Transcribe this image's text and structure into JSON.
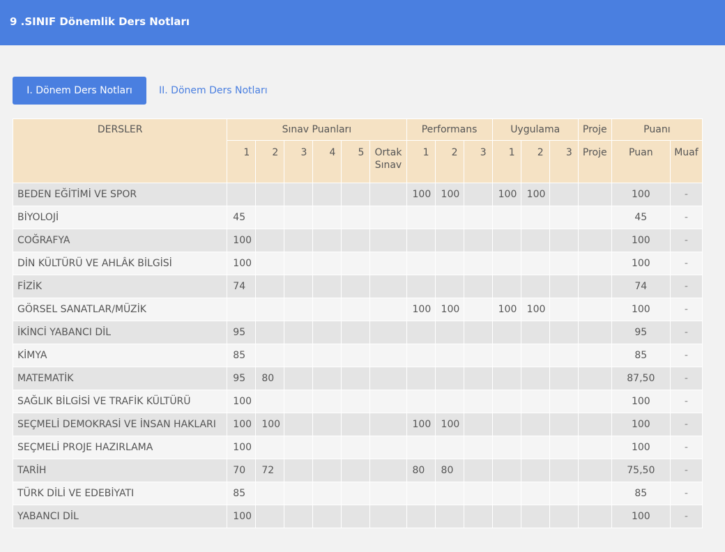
{
  "header": {
    "title": "9 .SINIF Dönemlik Ders Notları"
  },
  "tabs": [
    {
      "label": "I. Dönem Ders Notları",
      "active": true
    },
    {
      "label": "II. Dönem Ders Notları",
      "active": false
    }
  ],
  "colors": {
    "accent": "#4a7fe0",
    "header_bg": "#f5e2c4"
  },
  "table": {
    "group_headers": {
      "subjects": "DERSLER",
      "exam": "Sınav Puanları",
      "performance": "Performans",
      "application": "Uygulama",
      "project": "Proje",
      "score": "Puanı"
    },
    "sub_headers": {
      "e1": "1",
      "e2": "2",
      "e3": "3",
      "e4": "4",
      "e5": "5",
      "ortak_line1": "Ortak",
      "ortak_line2": "Sınav",
      "p1": "1",
      "p2": "2",
      "p3": "3",
      "u1": "1",
      "u2": "2",
      "u3": "3",
      "proje": "Proje",
      "puan": "Puan",
      "muaf": "Muaf"
    },
    "rows": [
      {
        "subject": "BEDEN EĞİTİMİ VE SPOR",
        "s1": "",
        "s2": "",
        "s3": "",
        "s4": "",
        "s5": "",
        "ortak": "",
        "p1": "100",
        "p2": "100",
        "p3": "",
        "u1": "100",
        "u2": "100",
        "u3": "",
        "proje": "",
        "puan": "100",
        "muaf": "-"
      },
      {
        "subject": "BİYOLOJİ",
        "s1": "45",
        "s2": "",
        "s3": "",
        "s4": "",
        "s5": "",
        "ortak": "",
        "p1": "",
        "p2": "",
        "p3": "",
        "u1": "",
        "u2": "",
        "u3": "",
        "proje": "",
        "puan": "45",
        "muaf": "-"
      },
      {
        "subject": "COĞRAFYA",
        "s1": "100",
        "s2": "",
        "s3": "",
        "s4": "",
        "s5": "",
        "ortak": "",
        "p1": "",
        "p2": "",
        "p3": "",
        "u1": "",
        "u2": "",
        "u3": "",
        "proje": "",
        "puan": "100",
        "muaf": "-"
      },
      {
        "subject": "DİN KÜLTÜRÜ VE AHLÂK BİLGİSİ",
        "s1": "100",
        "s2": "",
        "s3": "",
        "s4": "",
        "s5": "",
        "ortak": "",
        "p1": "",
        "p2": "",
        "p3": "",
        "u1": "",
        "u2": "",
        "u3": "",
        "proje": "",
        "puan": "100",
        "muaf": "-"
      },
      {
        "subject": "FİZİK",
        "s1": "74",
        "s2": "",
        "s3": "",
        "s4": "",
        "s5": "",
        "ortak": "",
        "p1": "",
        "p2": "",
        "p3": "",
        "u1": "",
        "u2": "",
        "u3": "",
        "proje": "",
        "puan": "74",
        "muaf": "-"
      },
      {
        "subject": "GÖRSEL SANATLAR/MÜZİK",
        "s1": "",
        "s2": "",
        "s3": "",
        "s4": "",
        "s5": "",
        "ortak": "",
        "p1": "100",
        "p2": "100",
        "p3": "",
        "u1": "100",
        "u2": "100",
        "u3": "",
        "proje": "",
        "puan": "100",
        "muaf": "-"
      },
      {
        "subject": "İKİNCİ YABANCI DİL",
        "s1": "95",
        "s2": "",
        "s3": "",
        "s4": "",
        "s5": "",
        "ortak": "",
        "p1": "",
        "p2": "",
        "p3": "",
        "u1": "",
        "u2": "",
        "u3": "",
        "proje": "",
        "puan": "95",
        "muaf": "-"
      },
      {
        "subject": "KİMYA",
        "s1": "85",
        "s2": "",
        "s3": "",
        "s4": "",
        "s5": "",
        "ortak": "",
        "p1": "",
        "p2": "",
        "p3": "",
        "u1": "",
        "u2": "",
        "u3": "",
        "proje": "",
        "puan": "85",
        "muaf": "-"
      },
      {
        "subject": "MATEMATİK",
        "s1": "95",
        "s2": "80",
        "s3": "",
        "s4": "",
        "s5": "",
        "ortak": "",
        "p1": "",
        "p2": "",
        "p3": "",
        "u1": "",
        "u2": "",
        "u3": "",
        "proje": "",
        "puan": "87,50",
        "muaf": "-"
      },
      {
        "subject": "SAĞLIK BİLGİSİ VE TRAFİK KÜLTÜRÜ",
        "s1": "100",
        "s2": "",
        "s3": "",
        "s4": "",
        "s5": "",
        "ortak": "",
        "p1": "",
        "p2": "",
        "p3": "",
        "u1": "",
        "u2": "",
        "u3": "",
        "proje": "",
        "puan": "100",
        "muaf": "-"
      },
      {
        "subject": "SEÇMELİ DEMOKRASİ VE İNSAN HAKLARI",
        "s1": "100",
        "s2": "100",
        "s3": "",
        "s4": "",
        "s5": "",
        "ortak": "",
        "p1": "100",
        "p2": "100",
        "p3": "",
        "u1": "",
        "u2": "",
        "u3": "",
        "proje": "",
        "puan": "100",
        "muaf": "-"
      },
      {
        "subject": "SEÇMELİ PROJE HAZIRLAMA",
        "s1": "100",
        "s2": "",
        "s3": "",
        "s4": "",
        "s5": "",
        "ortak": "",
        "p1": "",
        "p2": "",
        "p3": "",
        "u1": "",
        "u2": "",
        "u3": "",
        "proje": "",
        "puan": "100",
        "muaf": "-"
      },
      {
        "subject": "TARİH",
        "s1": "70",
        "s2": "72",
        "s3": "",
        "s4": "",
        "s5": "",
        "ortak": "",
        "p1": "80",
        "p2": "80",
        "p3": "",
        "u1": "",
        "u2": "",
        "u3": "",
        "proje": "",
        "puan": "75,50",
        "muaf": "-"
      },
      {
        "subject": "TÜRK DİLİ VE EDEBİYATI",
        "s1": "85",
        "s2": "",
        "s3": "",
        "s4": "",
        "s5": "",
        "ortak": "",
        "p1": "",
        "p2": "",
        "p3": "",
        "u1": "",
        "u2": "",
        "u3": "",
        "proje": "",
        "puan": "85",
        "muaf": "-"
      },
      {
        "subject": "YABANCI DİL",
        "s1": "100",
        "s2": "",
        "s3": "",
        "s4": "",
        "s5": "",
        "ortak": "",
        "p1": "",
        "p2": "",
        "p3": "",
        "u1": "",
        "u2": "",
        "u3": "",
        "proje": "",
        "puan": "100",
        "muaf": "-"
      }
    ]
  }
}
